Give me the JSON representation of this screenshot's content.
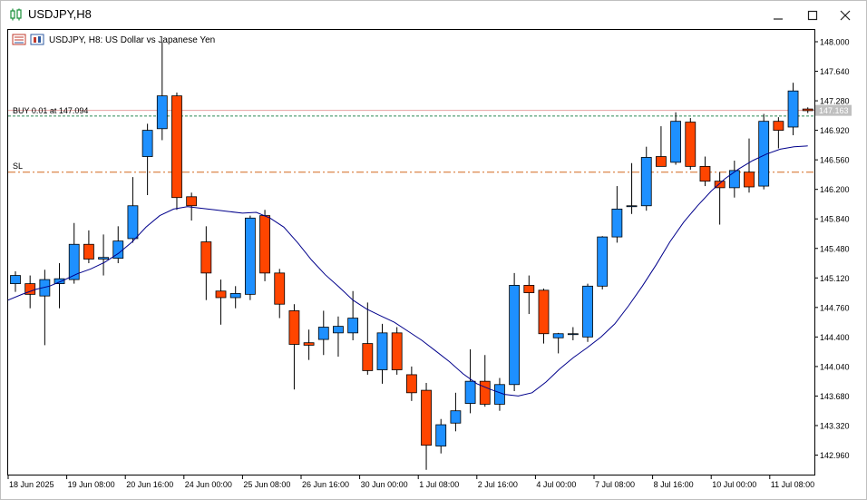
{
  "window": {
    "title": "USDJPY,H8"
  },
  "chart": {
    "header_text": "USDJPY, H8:  US Dollar vs Japanese Yen",
    "buy_label": "BUY 0.01 at 147.094",
    "sl_label": "SL",
    "current_price_label": "147.163",
    "colors": {
      "bull": "#1e90ff",
      "bear": "#ff4500",
      "ma": "#00008b",
      "buy_line": "#2e8b57",
      "sl_line": "#d2691e",
      "bid_line": "#e8a0a0"
    }
  },
  "chart_data": {
    "type": "candlestick",
    "symbol": "USDJPY",
    "timeframe": "H8",
    "y_ticks": [
      "148.000",
      "147.640",
      "147.280",
      "146.920",
      "146.560",
      "146.200",
      "145.840",
      "145.480",
      "145.120",
      "144.760",
      "144.400",
      "144.040",
      "143.680",
      "143.320",
      "142.960"
    ],
    "x_labels": [
      "18 Jun 2025",
      "19 Jun 08:00",
      "20 Jun 16:00",
      "24 Jun 00:00",
      "25 Jun 08:00",
      "26 Jun 16:00",
      "30 Jun 00:00",
      "1 Jul 08:00",
      "2 Jul 16:00",
      "4 Jul 00:00",
      "7 Jul 08:00",
      "8 Jul 16:00",
      "10 Jul 00:00",
      "11 Jul 08:00"
    ],
    "ylim": [
      142.62,
      148.06
    ],
    "levels": {
      "buy": 147.094,
      "sl": 146.41,
      "bid": 147.163
    },
    "candles": [
      [
        145.05,
        145.2,
        144.95,
        145.15
      ],
      [
        145.05,
        145.15,
        144.75,
        144.92
      ],
      [
        144.9,
        145.22,
        144.3,
        145.1
      ],
      [
        145.05,
        145.3,
        144.75,
        145.11
      ],
      [
        145.1,
        145.79,
        145.05,
        145.53
      ],
      [
        145.53,
        145.7,
        145.3,
        145.35
      ],
      [
        145.35,
        145.65,
        145.15,
        145.37
      ],
      [
        145.36,
        145.75,
        145.3,
        145.57
      ],
      [
        145.6,
        146.35,
        145.55,
        146.0
      ],
      [
        146.6,
        147.0,
        146.13,
        146.92
      ],
      [
        146.94,
        148.0,
        146.8,
        147.34
      ],
      [
        147.34,
        147.38,
        145.95,
        146.1
      ],
      [
        146.11,
        146.16,
        145.82,
        146.0
      ],
      [
        145.56,
        145.75,
        144.85,
        145.18
      ],
      [
        144.96,
        145.1,
        144.55,
        144.88
      ],
      [
        144.88,
        145.02,
        144.75,
        144.93
      ],
      [
        144.92,
        145.88,
        144.85,
        145.85
      ],
      [
        145.88,
        145.95,
        145.08,
        145.18
      ],
      [
        145.18,
        145.23,
        144.63,
        144.8
      ],
      [
        144.72,
        144.8,
        143.76,
        144.31
      ],
      [
        144.33,
        144.49,
        144.12,
        144.3
      ],
      [
        144.37,
        144.72,
        144.18,
        144.52
      ],
      [
        144.45,
        144.65,
        144.16,
        144.53
      ],
      [
        144.45,
        144.96,
        144.36,
        144.63
      ],
      [
        144.32,
        144.82,
        143.94,
        143.99
      ],
      [
        144.0,
        144.56,
        143.83,
        144.45
      ],
      [
        144.45,
        144.52,
        143.94,
        144.0
      ],
      [
        143.94,
        144.04,
        143.62,
        143.72
      ],
      [
        143.75,
        143.84,
        142.78,
        143.08
      ],
      [
        143.07,
        143.4,
        142.98,
        143.33
      ],
      [
        143.35,
        143.72,
        143.25,
        143.5
      ],
      [
        143.59,
        144.25,
        143.47,
        143.86
      ],
      [
        143.86,
        144.18,
        143.55,
        143.58
      ],
      [
        143.58,
        143.9,
        143.5,
        143.82
      ],
      [
        143.82,
        145.18,
        143.74,
        145.03
      ],
      [
        145.03,
        145.15,
        144.68,
        144.94
      ],
      [
        144.97,
        144.99,
        144.32,
        144.44
      ],
      [
        144.39,
        144.45,
        144.2,
        144.44
      ],
      [
        144.44,
        144.52,
        144.36,
        144.44
      ],
      [
        144.4,
        145.05,
        144.34,
        145.02
      ],
      [
        145.02,
        145.63,
        144.98,
        145.62
      ],
      [
        145.62,
        146.24,
        145.55,
        145.96
      ],
      [
        146.0,
        146.52,
        145.9,
        146.0
      ],
      [
        146.0,
        146.72,
        145.94,
        146.59
      ],
      [
        146.6,
        146.97,
        146.48,
        146.48
      ],
      [
        146.53,
        147.14,
        146.5,
        147.03
      ],
      [
        147.02,
        147.07,
        146.44,
        146.48
      ],
      [
        146.48,
        146.6,
        146.24,
        146.3
      ],
      [
        146.3,
        146.41,
        145.77,
        146.22
      ],
      [
        146.22,
        146.55,
        146.1,
        146.43
      ],
      [
        146.41,
        146.82,
        146.16,
        146.23
      ],
      [
        146.24,
        147.12,
        146.2,
        147.03
      ],
      [
        147.03,
        147.08,
        146.7,
        146.92
      ],
      [
        146.96,
        147.5,
        146.86,
        147.4
      ],
      [
        147.18,
        147.2,
        147.13,
        147.16
      ]
    ],
    "ma": [
      144.85,
      144.92,
      144.98,
      145.02,
      145.09,
      145.17,
      145.23,
      145.31,
      145.42,
      145.56,
      145.74,
      145.88,
      145.96,
      145.99,
      145.97,
      145.95,
      145.93,
      145.91,
      145.92,
      145.85,
      145.74,
      145.55,
      145.34,
      145.16,
      145.01,
      144.85,
      144.74,
      144.66,
      144.58,
      144.47,
      144.36,
      144.23,
      144.1,
      143.95,
      143.83,
      143.76,
      143.7,
      143.68,
      143.72,
      143.85,
      144.01,
      144.15,
      144.27,
      144.4,
      144.56,
      144.78,
      145.02,
      145.28,
      145.56,
      145.8,
      146.0,
      146.18,
      146.33,
      146.45,
      146.55,
      146.63,
      146.69,
      146.72,
      146.73
    ]
  }
}
